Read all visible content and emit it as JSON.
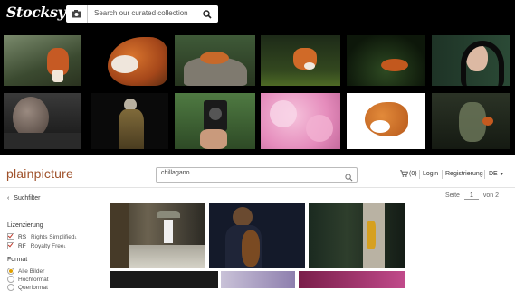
{
  "stocksy": {
    "logo": "Stocksy",
    "search_placeholder": "Search our curated collection",
    "icons": [
      "camera-icon",
      "search-icon"
    ]
  },
  "plainpicture": {
    "logo": "plainpicture",
    "search_value": "chillagano",
    "cart_count": "(0)",
    "login": "Login",
    "register": "Registrierung",
    "language": "DE",
    "back_filter": "Suchfilter",
    "pagination": {
      "label": "Seite",
      "current": "1",
      "of": "von 2"
    },
    "filters": {
      "license_heading": "Lizenzierung",
      "license_options": [
        {
          "code": "RS",
          "label": "Rights Simplified",
          "sup": "1"
        },
        {
          "code": "RF",
          "label": "Royalty Free",
          "sup": "1"
        }
      ],
      "format_heading": "Format",
      "format_options": [
        "Alle Bilder",
        "Hochformat",
        "Querformat"
      ]
    }
  },
  "colors": {
    "stocksy_bg": "#000000",
    "brand_accent": "#a0532c"
  }
}
